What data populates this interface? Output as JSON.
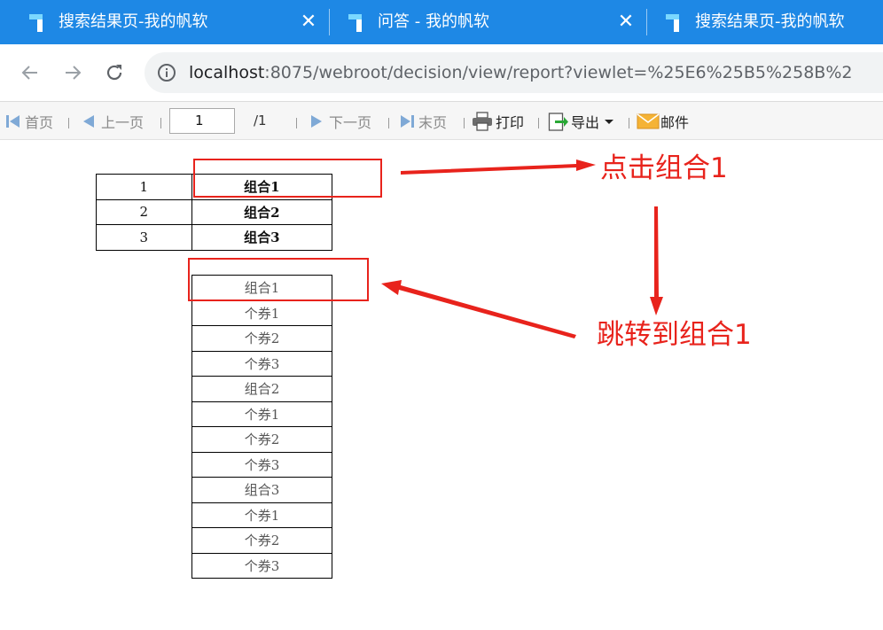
{
  "browser": {
    "tabs": [
      {
        "title": "搜索结果页-我的帆软",
        "close": "✕"
      },
      {
        "title": "问答 - 我的帆软",
        "close": "✕"
      },
      {
        "title": "搜索结果页-我的帆软",
        "close": ""
      }
    ],
    "address": {
      "host": "localhost",
      "rest": ":8075/webroot/decision/view/report?viewlet=%25E6%25B5%258B%2"
    },
    "colors": {
      "tabbar": "#1e88e5",
      "annotation": "#e8231c"
    }
  },
  "toolbar": {
    "first": "首页",
    "prev": "上一页",
    "page_current": "1",
    "page_total": "/1",
    "next": "下一页",
    "last": "末页",
    "print": "打印",
    "export": "导出",
    "mail": "邮件"
  },
  "report": {
    "table1": [
      {
        "num": "1",
        "group": "组合1"
      },
      {
        "num": "2",
        "group": "组合2"
      },
      {
        "num": "3",
        "group": "组合3"
      }
    ],
    "table2": [
      "组合1",
      "个券1",
      "个券2",
      "个券3",
      "组合2",
      "个券1",
      "个券2",
      "个券3",
      "组合3",
      "个券1",
      "个券2",
      "个券3"
    ]
  },
  "annotations": {
    "click_label": "点击组合1",
    "jump_label": "跳转到组合1"
  }
}
